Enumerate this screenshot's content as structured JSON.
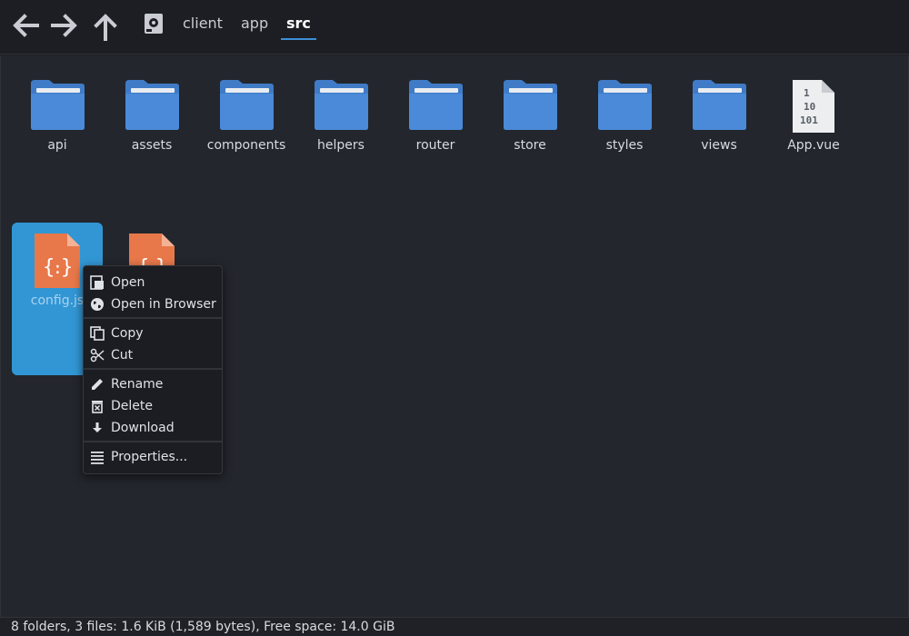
{
  "toolbar": {
    "back_icon": "arrow-left-icon",
    "forward_icon": "arrow-right-icon",
    "up_icon": "arrow-up-icon",
    "drive_icon": "drive-icon",
    "breadcrumbs": [
      {
        "label": "client",
        "active": false
      },
      {
        "label": "app",
        "active": false
      },
      {
        "label": "src",
        "active": true
      }
    ],
    "accent_color": "#3d8fd8"
  },
  "folders": [
    {
      "name": "api"
    },
    {
      "name": "assets"
    },
    {
      "name": "components"
    },
    {
      "name": "helpers"
    },
    {
      "name": "router"
    },
    {
      "name": "store"
    },
    {
      "name": "styles"
    },
    {
      "name": "views"
    }
  ],
  "files": [
    {
      "name": "App.vue",
      "icon": "binary-file-icon"
    },
    {
      "name": "config.js",
      "icon": "json-file-icon",
      "selected": true
    },
    {
      "name": "",
      "icon": "json-file-icon"
    }
  ],
  "context_menu": {
    "items": [
      {
        "label": "Open",
        "icon": "open-icon"
      },
      {
        "label": "Open in Browser",
        "icon": "globe-icon"
      },
      {
        "label": "Copy",
        "icon": "copy-icon"
      },
      {
        "label": "Cut",
        "icon": "scissors-icon"
      },
      {
        "label": "Rename",
        "icon": "pencil-icon"
      },
      {
        "label": "Delete",
        "icon": "trash-icon"
      },
      {
        "label": "Download",
        "icon": "download-icon"
      },
      {
        "label": "Properties...",
        "icon": "list-icon"
      }
    ]
  },
  "status": {
    "text": "8 folders, 3 files: 1.6 KiB (1,589 bytes), Free space: 14.0 GiB"
  },
  "colors": {
    "folder": "#4a8ad8",
    "folder_tab": "#3f7bc6",
    "js_file": "#e8784a",
    "selection": "#3296d4"
  }
}
